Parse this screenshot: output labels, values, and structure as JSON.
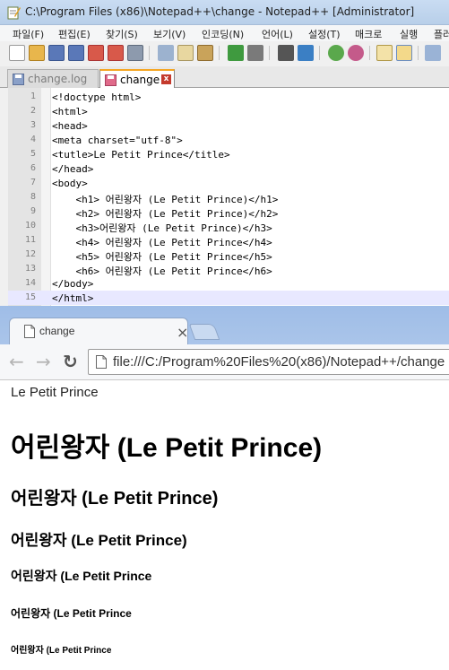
{
  "notepad": {
    "title": "C:\\Program Files (x86)\\Notepad++\\change - Notepad++ [Administrator]",
    "menu": [
      "파일(F)",
      "편집(E)",
      "찾기(S)",
      "보기(V)",
      "인코딩(N)",
      "언어(L)",
      "설정(T)",
      "매크로",
      "실행",
      "플러"
    ],
    "tabs": [
      {
        "label": "change.log",
        "active": false
      },
      {
        "label": "change",
        "active": true,
        "close": "x"
      }
    ],
    "lines": [
      {
        "n": "1",
        "text": "<!doctype html>"
      },
      {
        "n": "2",
        "text": "<html>"
      },
      {
        "n": "3",
        "text": "<head>"
      },
      {
        "n": "4",
        "text": "<meta charset=\"utf-8\">"
      },
      {
        "n": "5",
        "text": "<tutle>Le Petit Prince</title>"
      },
      {
        "n": "6",
        "text": "</head>"
      },
      {
        "n": "7",
        "text": "<body>"
      },
      {
        "n": "8",
        "text": "    <h1> 어린왕자 (Le Petit Prince)</h1>"
      },
      {
        "n": "9",
        "text": "    <h2> 어린왕자 (Le Petit Prince)</h2>"
      },
      {
        "n": "10",
        "text": "    <h3>어린왕자 (Le Petit Prince)</h3>"
      },
      {
        "n": "11",
        "text": "    <h4> 어린왕자 (Le Petit Prince</h4>"
      },
      {
        "n": "12",
        "text": "    <h5> 어린왕자 (Le Petit Prince</h5>"
      },
      {
        "n": "13",
        "text": "    <h6> 어린왕자 (Le Petit Prince</h6>"
      },
      {
        "n": "14",
        "text": "</body>"
      },
      {
        "n": "15",
        "text": "</html>"
      }
    ],
    "current_line": "15"
  },
  "browser": {
    "tab_title": "change",
    "tab_close": "×",
    "url": "file:///C:/Program%20Files%20(x86)/Notepad++/change",
    "page": {
      "title_text": "Le Petit Prince",
      "h1": "어린왕자 (Le Petit Prince)",
      "h2": "어린왕자 (Le Petit Prince)",
      "h3": "어린왕자 (Le Petit Prince)",
      "h4": "어린왕자 (Le Petit Prince",
      "h5": "어린왕자 (Le Petit Prince",
      "h6": "어린왕자 (Le Petit Prince"
    }
  }
}
